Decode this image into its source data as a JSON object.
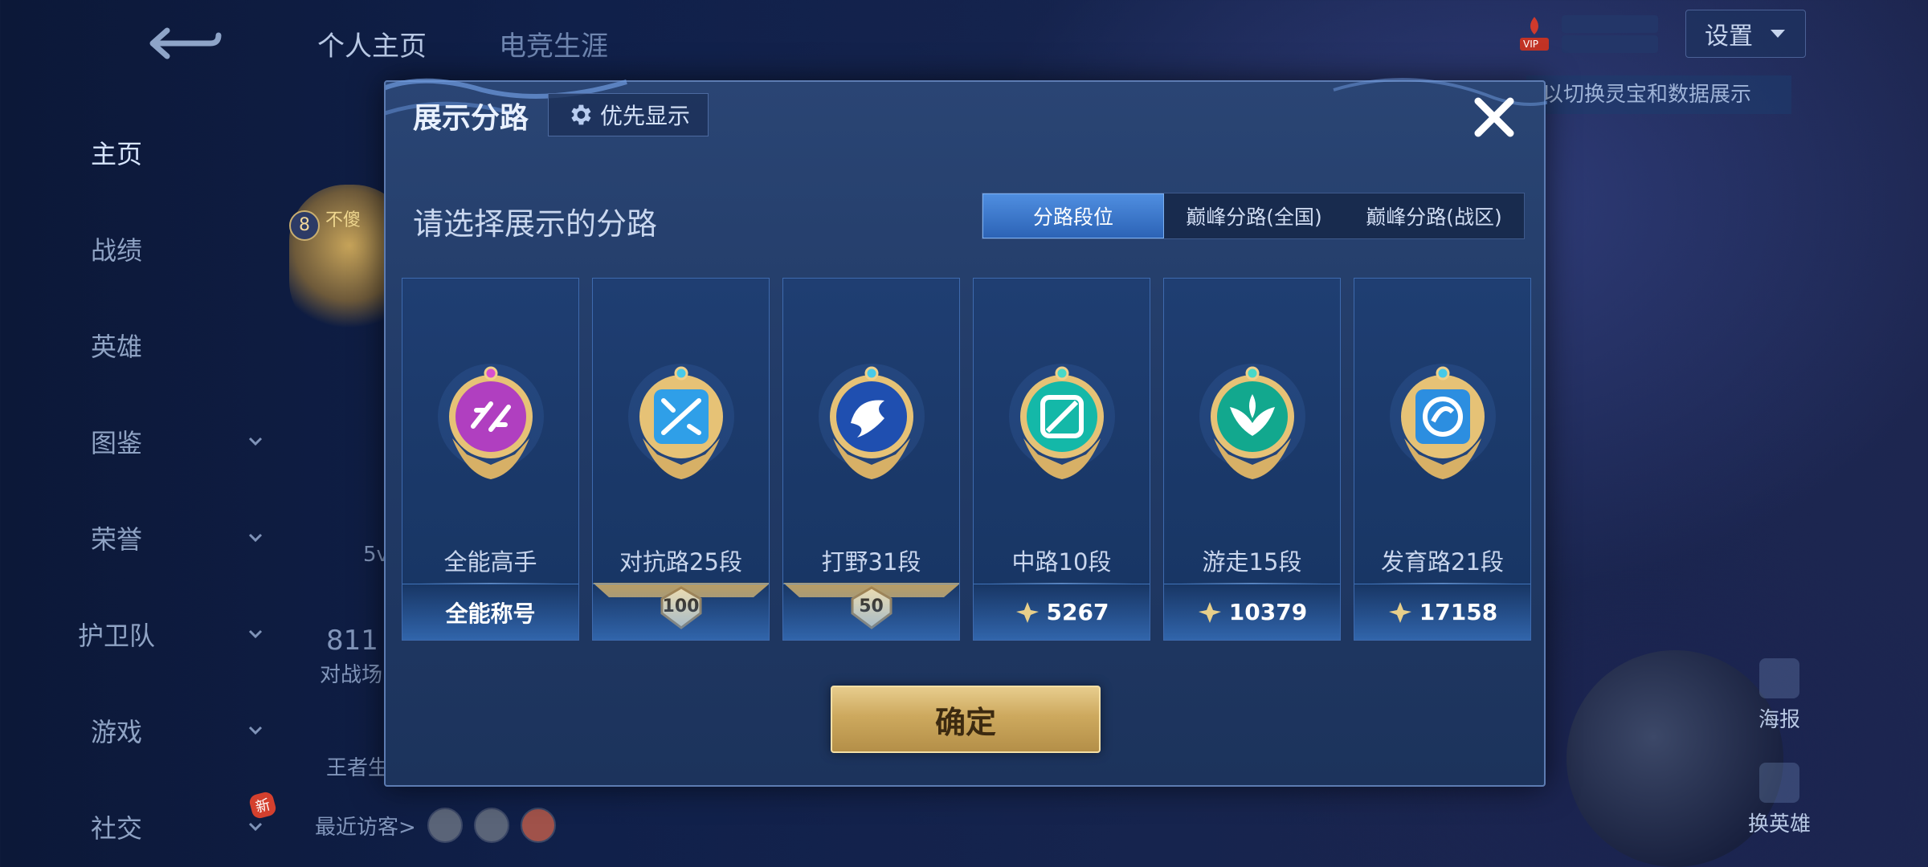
{
  "background": {
    "top_tabs": [
      "个人主页",
      "电竞生涯"
    ],
    "left_nav": [
      {
        "label": "主页",
        "active": true,
        "chevron": false
      },
      {
        "label": "战绩",
        "active": false,
        "chevron": false
      },
      {
        "label": "英雄",
        "active": false,
        "chevron": false
      },
      {
        "label": "图鉴",
        "active": false,
        "chevron": true
      },
      {
        "label": "荣誉",
        "active": false,
        "chevron": true
      },
      {
        "label": "护卫队",
        "active": false,
        "chevron": true
      },
      {
        "label": "游戏",
        "active": false,
        "chevron": true
      },
      {
        "label": "社交",
        "active": false,
        "chevron": true,
        "badge": "新"
      }
    ],
    "level": "8",
    "vip_label": "VIP",
    "settings_label": "设置",
    "hint_text": "以切换灵宝和数据展示",
    "recent_visitors_label": "最近访客>",
    "partial_texts": [
      "不傻",
      "5v",
      "811",
      "对战场",
      "王者生"
    ],
    "side_actions": [
      "海报",
      "换英雄"
    ]
  },
  "modal": {
    "title": "展示分路",
    "priority_button": "优先显示",
    "subtitle": "请选择展示的分路",
    "tabs": [
      "分路段位",
      "巅峰分路(全国)",
      "巅峰分路(战区)"
    ],
    "active_tab": 0,
    "confirm_label": "确定",
    "cards": [
      {
        "title": "全能高手",
        "bottom_text": "全能称号",
        "medal_color": "#b03fc0",
        "icon": "allround-emblem-icon"
      },
      {
        "title": "对抗路25段",
        "star_count": "100",
        "medal_color": "#2f9fe8",
        "icon": "clash-lane-sword-icon"
      },
      {
        "title": "打野31段",
        "star_count": "50",
        "medal_color": "#1f4fb0",
        "icon": "jungle-dragon-icon"
      },
      {
        "title": "中路10段",
        "score": "5267",
        "medal_color": "#14b8a8",
        "icon": "mid-lane-icon"
      },
      {
        "title": "游走15段",
        "score": "10379",
        "medal_color": "#12a88e",
        "icon": "roam-wings-icon"
      },
      {
        "title": "发育路21段",
        "score": "17158",
        "medal_color": "#2c8ee0",
        "icon": "farm-lane-icon"
      }
    ]
  },
  "colors": {
    "accent_blue": "#2c63b6",
    "gold": "#cda95e"
  }
}
